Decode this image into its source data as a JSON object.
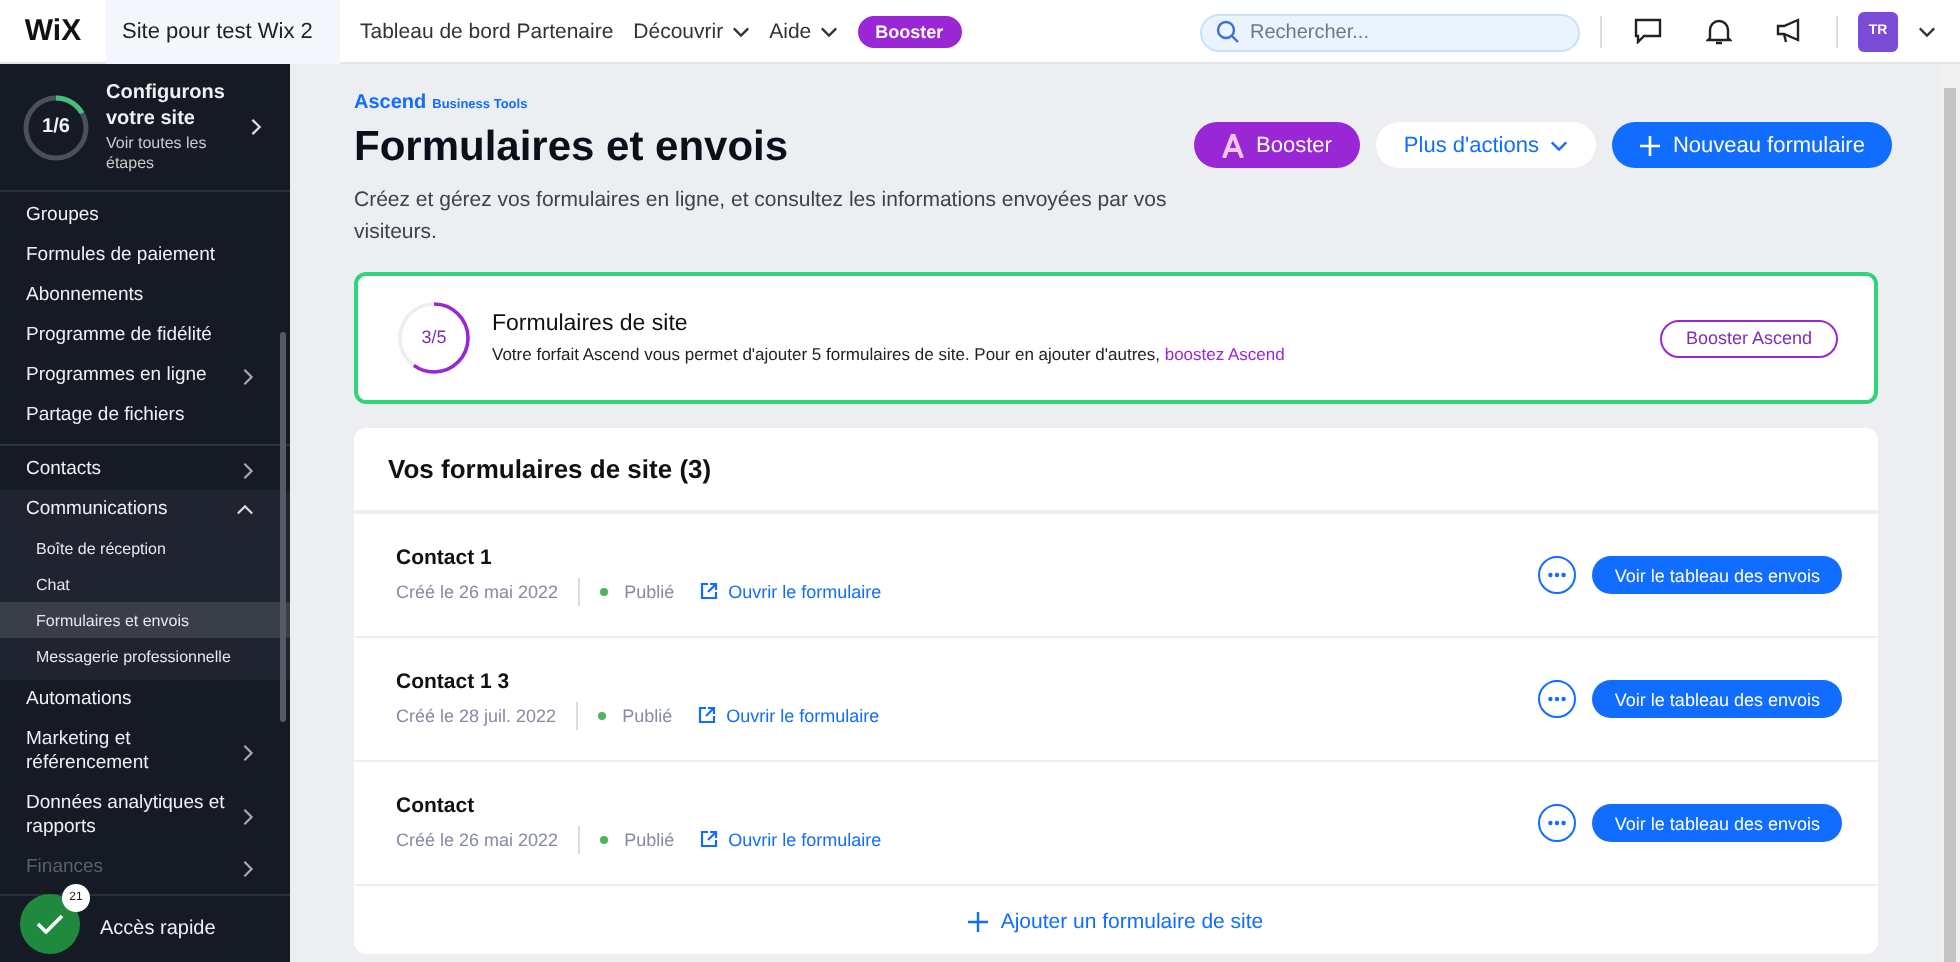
{
  "topbar": {
    "logo": "WiX",
    "site_selector": "Site pour test Wix 2",
    "nav": [
      {
        "label": "Tableau de bord Partenaire",
        "kind": "link"
      },
      {
        "label": "Découvrir",
        "kind": "menu"
      },
      {
        "label": "Aide",
        "kind": "menu"
      }
    ],
    "booster": "Booster",
    "search": {
      "placeholder": "Rechercher..."
    },
    "avatar": "TR"
  },
  "setup": {
    "progress": "1/6",
    "level": 0.167,
    "title": "Configurons votre site",
    "link": "Voir toutes les étapes"
  },
  "sidebar": {
    "groups": [
      [
        {
          "label": "Groupes",
          "expandable": false,
          "expanded": false,
          "disabled": false
        },
        {
          "label": "Formules de paiement",
          "expandable": false,
          "expanded": false,
          "disabled": false
        },
        {
          "label": "Abonnements",
          "expandable": false,
          "expanded": false,
          "disabled": false
        },
        {
          "label": "Programme de fidélité",
          "expandable": false,
          "expanded": false,
          "disabled": false
        },
        {
          "label": "Programmes en ligne",
          "expandable": true,
          "expanded": false,
          "disabled": false
        },
        {
          "label": "Partage de fichiers",
          "expandable": false,
          "expanded": false,
          "disabled": false
        }
      ],
      [
        {
          "label": "Contacts",
          "expandable": true,
          "expanded": false,
          "disabled": false
        },
        {
          "label": "Communications",
          "expandable": true,
          "expanded": true,
          "disabled": false,
          "children": [
            {
              "label": "Boîte de réception",
              "selected": false
            },
            {
              "label": "Chat",
              "selected": false
            },
            {
              "label": "Formulaires et envois",
              "selected": true
            },
            {
              "label": "Messagerie professionnelle",
              "selected": false
            }
          ]
        },
        {
          "label": "Automations",
          "expandable": false,
          "expanded": false,
          "disabled": false
        },
        {
          "label": "Marketing et référencement",
          "expandable": true,
          "expanded": false,
          "disabled": false
        },
        {
          "label": "Données analytiques et rapports",
          "expandable": true,
          "expanded": false,
          "disabled": false
        },
        {
          "label": "Finances",
          "expandable": true,
          "expanded": false,
          "disabled": true
        }
      ]
    ],
    "quick_access": {
      "label": "Accès rapide",
      "badge": "21"
    }
  },
  "header": {
    "brand": "Ascend",
    "brand_sub": "Business Tools",
    "title": "Formulaires et envois",
    "description": "Créez et gérez vos formulaires en ligne, et consultez les informations envoyées par vos visiteurs.",
    "actions": [
      {
        "label": "Booster",
        "kind": "upgrade"
      },
      {
        "label": "Plus d'actions",
        "kind": "menu"
      },
      {
        "label": "Nouveau formulaire",
        "kind": "primary"
      }
    ]
  },
  "quota": {
    "progress": "3/5",
    "level": 0.6,
    "title": "Formulaires de site",
    "text": "Votre forfait Ascend vous permet d'ajouter 5 formulaires de site. Pour en ajouter d'autres,",
    "link": "boostez Ascend",
    "button": "Booster Ascend"
  },
  "forms": {
    "title": "Vos formulaires de site (3)",
    "rows": [
      {
        "name": "Contact 1",
        "created": "Créé le 26 mai 2022",
        "status": "Publié",
        "published": true,
        "open_link": "Ouvrir le formulaire",
        "button": "Voir le tableau des envois"
      },
      {
        "name": "Contact 1 3",
        "created": "Créé le 28 juil. 2022",
        "status": "Publié",
        "published": true,
        "open_link": "Ouvrir le formulaire",
        "button": "Voir le tableau des envois"
      },
      {
        "name": "Contact",
        "created": "Créé le 26 mai 2022",
        "status": "Publié",
        "published": true,
        "open_link": "Ouvrir le formulaire",
        "button": "Voir le tableau des envois"
      }
    ],
    "add": "Ajouter un formulaire de site"
  }
}
